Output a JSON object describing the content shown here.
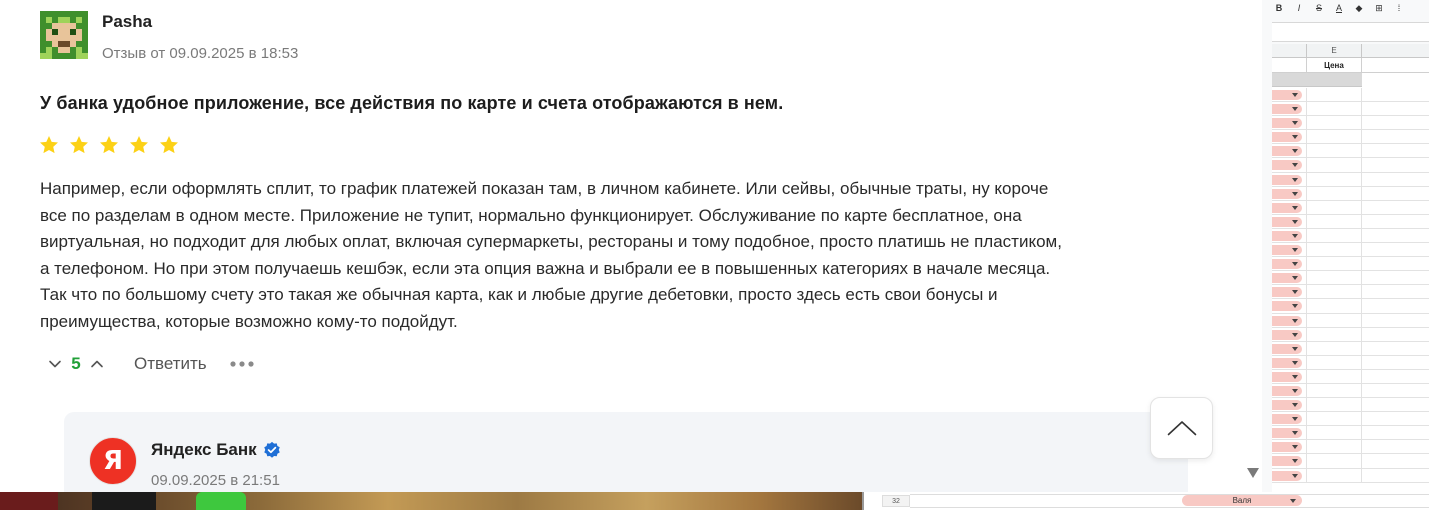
{
  "review": {
    "author": "Pasha",
    "date": "Отзыв от 09.09.2025 в 18:53",
    "title": "У банка удобное приложение, все действия по карте и счета отображаются в нем.",
    "rating": 5,
    "rating_max": 5,
    "body_lines": [
      "Например, если оформлять сплит, то график платежей показан там, в личном кабинете. Или сейвы, обычные траты, ну короче",
      "все по разделам в одном месте. Приложение не тупит, нормально функционирует. Обслуживание по карте бесплатное, она",
      "виртуальная, но подходит для любых оплат, включая супермаркеты, рестораны и тому подобное, просто платишь не пластиком,",
      "а телефоном. Но при этом получаешь кешбэк, если эта опция важна и выбрали ее в повышенных категориях в начале месяца.",
      "Так что по большому счету это такая же обычная карта, как и любые другие дебетовки, просто здесь есть свои бонусы и",
      "преимущества, которые возможно кому-то подойдут."
    ],
    "vote_count": "5",
    "reply_label": "Ответить"
  },
  "bank_reply": {
    "name": "Яндекс Банк",
    "logo_letter": "Я",
    "date": "09.09.2025 в 21:51"
  },
  "spreadsheet": {
    "toolbar": [
      "B",
      "I",
      "S",
      "A",
      "◆",
      "⊞",
      "⁞"
    ],
    "column_letter": "E",
    "column_header": "Цена",
    "bottom_row_number": "32",
    "bottom_row_value": "Валя"
  },
  "colors": {
    "star": "#fcd116",
    "vote_count": "#21a038",
    "bank_logo": "#ee3124",
    "verified": "#1f6fd6",
    "chip": "#f8c9c4"
  }
}
